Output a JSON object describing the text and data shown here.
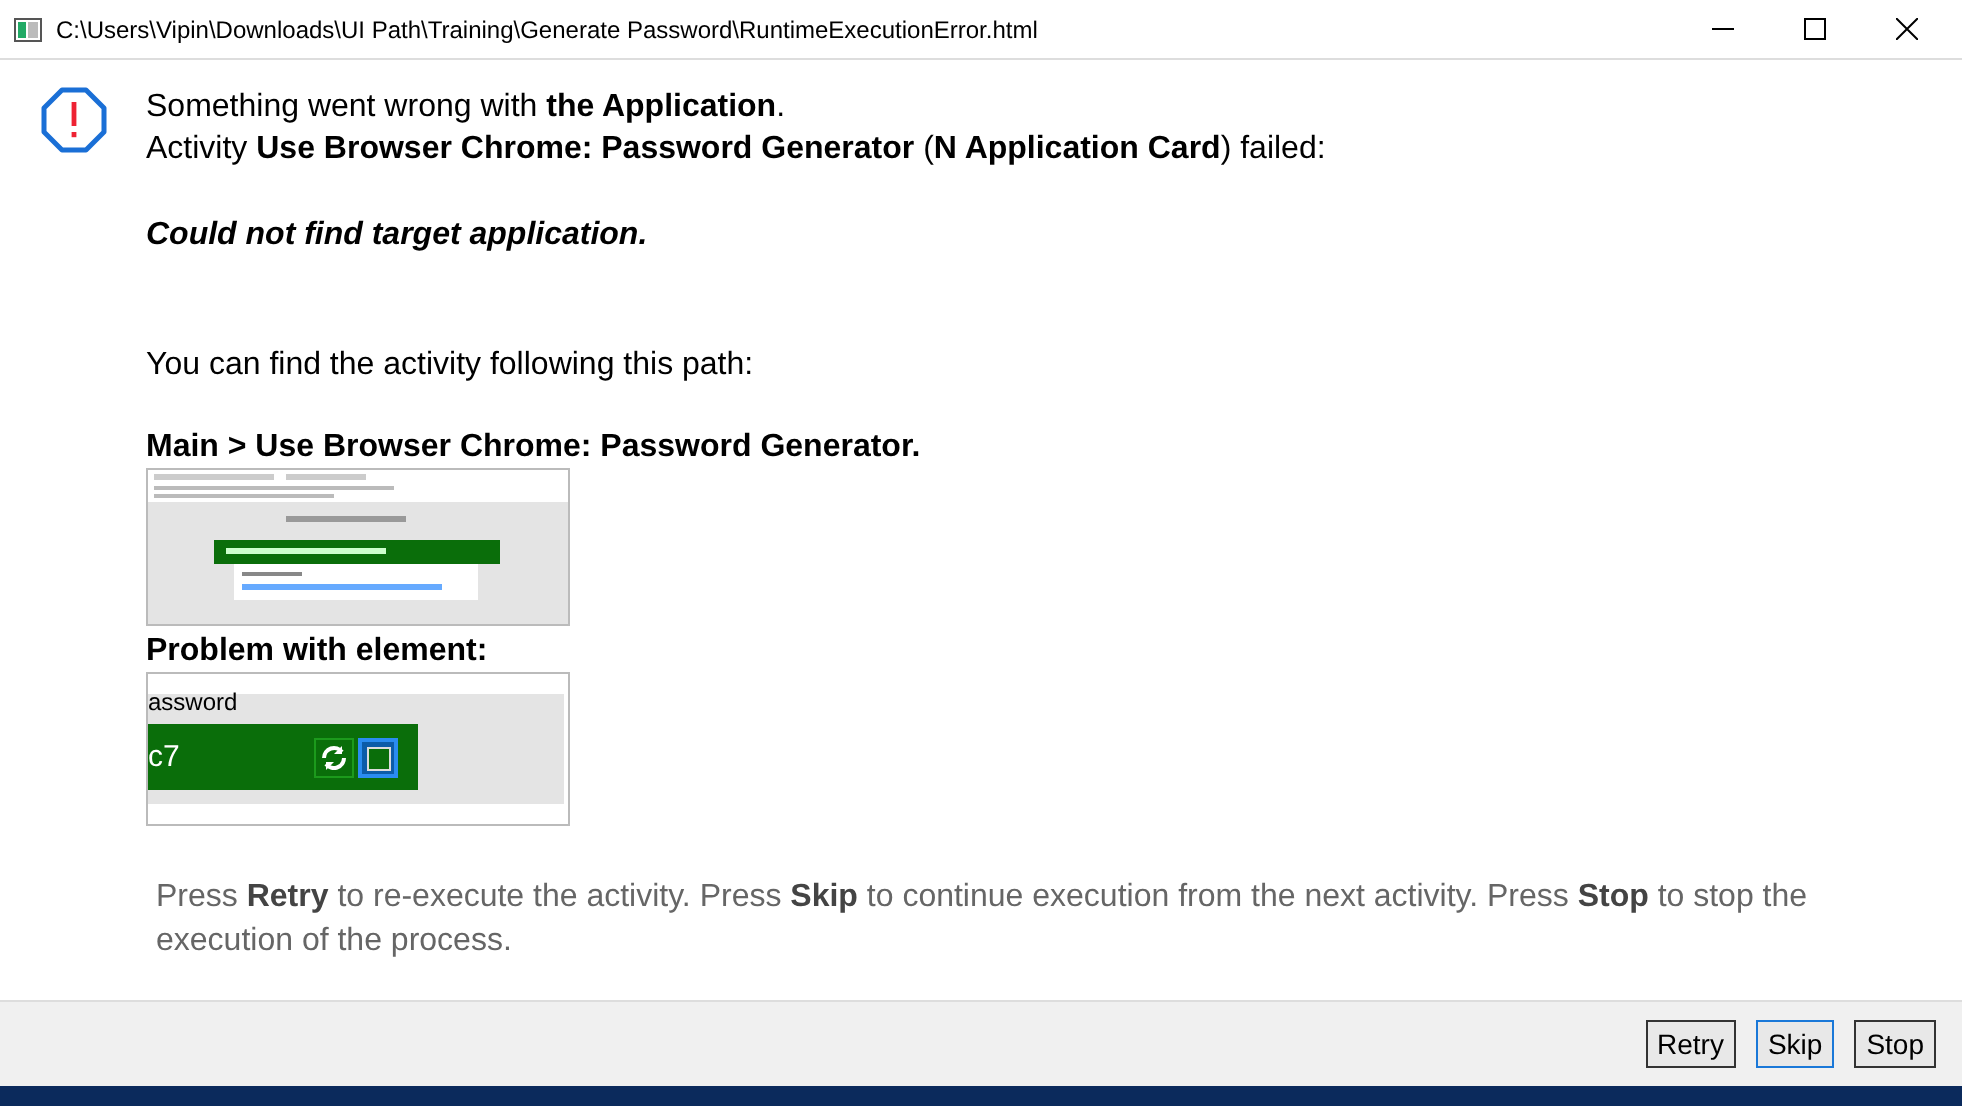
{
  "window": {
    "title": "C:\\Users\\Vipin\\Downloads\\UI Path\\Training\\Generate Password\\RuntimeExecutionError.html"
  },
  "message": {
    "line_1": "Something went wrong with **the Application**.",
    "line_2": "Activity **Use Browser Chrome: Password Generator** (**N Application Card**) failed:",
    "error": "Could not find target application.",
    "path_intro": "You can find the activity following this path:",
    "path": "Main > Use Browser Chrome: Password Generator.",
    "problem_heading": "Problem with element:",
    "element_shot": {
      "label": "assword",
      "value": "c7"
    }
  },
  "hint": "Press **Retry** to re-execute the activity. Press **Skip** to continue execution from the next activity. Press **Stop** to stop the execution of the process.",
  "buttons": [
    {
      "label": "Retry",
      "selected": false
    },
    {
      "label": "Skip",
      "selected": true
    },
    {
      "label": "Stop",
      "selected": false
    }
  ]
}
